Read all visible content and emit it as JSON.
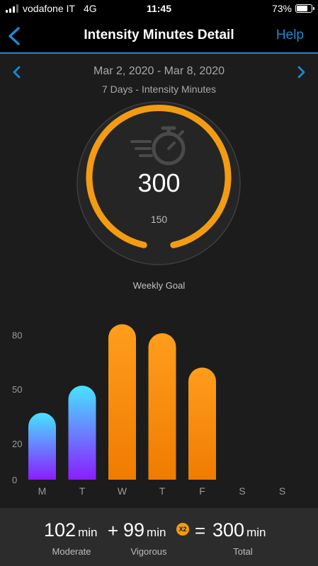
{
  "status_bar": {
    "carrier": "vodafone IT",
    "network": "4G",
    "time": "11:45",
    "battery": "73%",
    "battery_fraction": 0.73
  },
  "nav": {
    "back_icon": "chevron-left-icon",
    "title": "Intensity Minutes Detail",
    "help_label": "Help"
  },
  "date_nav": {
    "range": "Mar 2, 2020 - Mar 8, 2020",
    "subtitle": "7 Days - Intensity Minutes"
  },
  "gauge": {
    "value": "300",
    "goal": "150",
    "label": "Weekly Goal",
    "icon": "stopwatch-icon",
    "accent": "#f39c12"
  },
  "summary": {
    "moderate_value": "102",
    "moderate_unit": "min",
    "moderate_label": "Moderate",
    "plus": "+",
    "vigorous_value": "99",
    "vigorous_unit": "min",
    "multiplier": "X2",
    "vigorous_label": "Vigorous",
    "equals": "=",
    "total_value": "300",
    "total_unit": "min",
    "total_label": "Total"
  },
  "chart_data": {
    "type": "bar",
    "categories": [
      "M",
      "T",
      "W",
      "T",
      "F",
      "S",
      "S"
    ],
    "values": [
      37,
      52,
      86,
      81,
      62,
      0,
      0
    ],
    "intensity": [
      "moderate",
      "moderate",
      "vigorous",
      "vigorous",
      "vigorous",
      "none",
      "none"
    ],
    "y_ticks": [
      0,
      20,
      50,
      80
    ],
    "ylim": [
      0,
      90
    ],
    "colors": {
      "moderate_top": "#48e3ff",
      "moderate_bottom": "#8a1dff",
      "vigorous_top": "#ff9d1c",
      "vigorous_bottom": "#ef7c00"
    }
  }
}
